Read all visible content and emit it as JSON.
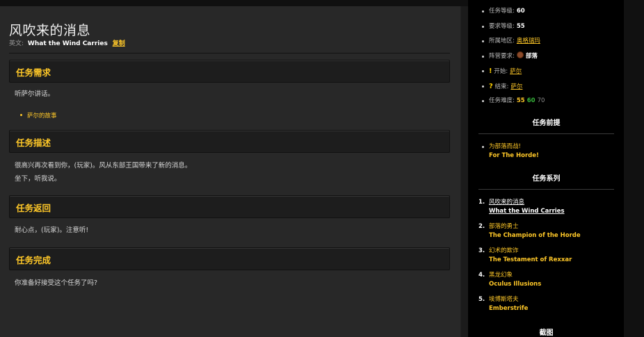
{
  "quest": {
    "title": "风吹来的消息",
    "english_label": "英文:",
    "english_name": "What the Wind Carries",
    "copy_label": "复制"
  },
  "sections": {
    "requirements": {
      "heading": "任务需求",
      "text": "听萨尔讲话。",
      "objectives": [
        "萨尔的故事"
      ]
    },
    "description": {
      "heading": "任务描述",
      "lines": [
        "很高兴再次看到你，(玩家)。风从东部王国带来了新的消息。",
        "坐下，听我说。"
      ]
    },
    "return": {
      "heading": "任务返回",
      "text": "耐心点，(玩家)。注意听!"
    },
    "complete": {
      "heading": "任务完成",
      "text": "你准备好接受这个任务了吗?"
    }
  },
  "info": {
    "level_label": "任务等级:",
    "level_value": "60",
    "req_level_label": "要求等级:",
    "req_level_value": "55",
    "zone_label": "所属地区:",
    "zone_value": "奥格瑞玛",
    "faction_label": "阵营要求:",
    "faction_value": "部落",
    "start_mark": "!",
    "start_label": "开始:",
    "start_value": "萨尔",
    "end_mark": "?",
    "end_label": "结束:",
    "end_value": "萨尔",
    "difficulty_label": "任务难度:",
    "difficulty_values": [
      "55",
      "60",
      "70"
    ]
  },
  "prerequisites": {
    "heading": "任务前提",
    "items": [
      {
        "cn": "为部落而战!",
        "en": "For The Horde!"
      }
    ]
  },
  "series": {
    "heading": "任务系列",
    "items": [
      {
        "num": "1.",
        "cn": "风吹来的消息",
        "en": "What the Wind Carries"
      },
      {
        "num": "2.",
        "cn": "部落的勇士",
        "en": "The Champion of the Horde"
      },
      {
        "num": "3.",
        "cn": "幻术的欺诈",
        "en": "The Testament of Rexxar"
      },
      {
        "num": "4.",
        "cn": "黑龙幻象",
        "en": "Oculus Illusions"
      },
      {
        "num": "5.",
        "cn": "埃博斯塔夫",
        "en": "Emberstrife"
      }
    ]
  },
  "screenshots_heading": "截图",
  "colors": {
    "accent": "#ffc828",
    "green": "#36b43a",
    "panel": "#282828",
    "sidebar": "#000000"
  }
}
